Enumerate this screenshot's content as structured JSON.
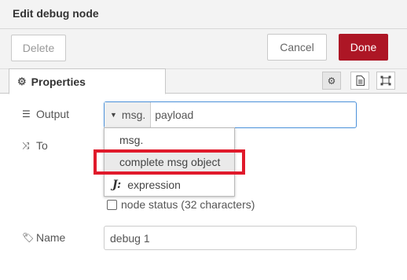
{
  "dialog": {
    "title": "Edit debug node"
  },
  "toolbar": {
    "delete_label": "Delete",
    "cancel_label": "Cancel",
    "done_label": "Done"
  },
  "tabs": {
    "properties_label": "Properties"
  },
  "form": {
    "output_label": "Output",
    "to_label": "To",
    "name_label": "Name",
    "output_type": "msg.",
    "output_value": "payload",
    "status_label": "node status (32 characters)",
    "name_value": "debug 1"
  },
  "dropdown": {
    "items": [
      {
        "label": "msg."
      },
      {
        "label": "complete msg object"
      },
      {
        "label": "expression",
        "icon": "J:"
      }
    ]
  },
  "colors": {
    "done": "#ad1625",
    "highlight": "#e01a2b",
    "focus": "#4a90d9"
  }
}
